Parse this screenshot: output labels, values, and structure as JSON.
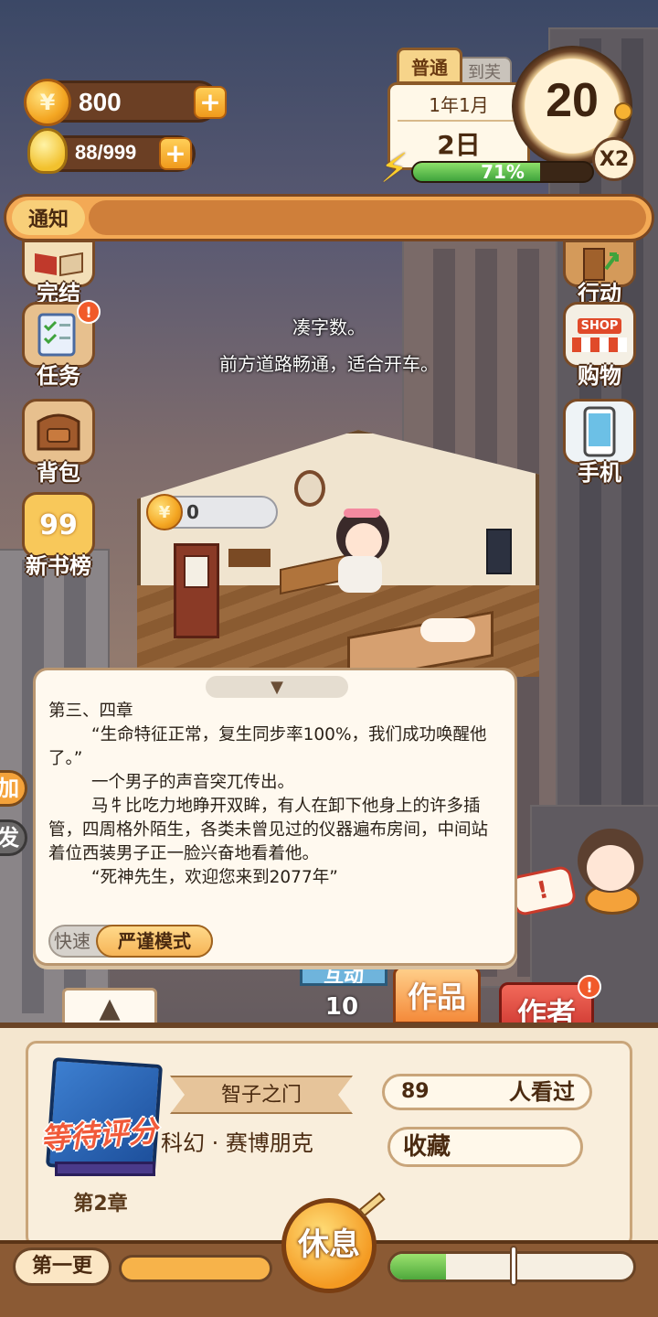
{
  "resources": {
    "coins": "800",
    "bulbs": "88/999",
    "coin_glyph": "¥"
  },
  "date": {
    "mode_active": "普通",
    "mode_inactive": "到芙",
    "year_month": "1年1月",
    "day": "2日",
    "clock_value": "20",
    "speed": "X2",
    "energy_percent": "71%",
    "energy_fraction": 0.71
  },
  "notice": {
    "label": "通知"
  },
  "left_menu": [
    {
      "label": "完结",
      "icon": "book-open-icon"
    },
    {
      "label": "任务",
      "icon": "checklist-icon"
    },
    {
      "label": "背包",
      "icon": "backpack-icon"
    },
    {
      "label": "新书榜",
      "icon": "ranking-medal-icon",
      "badge": "99"
    }
  ],
  "right_menu": [
    {
      "label": "行动",
      "icon": "door-arrow-icon"
    },
    {
      "label": "购物",
      "icon": "shop-icon",
      "sign": "SHOP"
    },
    {
      "label": "手机",
      "icon": "phone-icon"
    }
  ],
  "floating_text": {
    "line1": "凑字数。",
    "line2": "前方道路畅通，适合开车。"
  },
  "room": {
    "coin_count": "0"
  },
  "manuscript": {
    "text": "第三、四章\n        “生命特征正常，复生同步率100%，我们成功唤醒他了。”\n        一个男子的声音突兀传出。\n        马牜比吃力地睁开双眸，有人在卸下他身上的许多插管，四周格外陌生，各类未曾见过的仪器遍布房间，中间站着位西装男子正一脸兴奋地看着他。\n        “死神先生，欢迎您来到2077年”",
    "mode_fast": "快速",
    "mode_strict": "严谨模式",
    "collapse_glyph": "▼",
    "expand_glyph": "▲"
  },
  "tabs": {
    "interact_label": "互动",
    "interact_count": "10",
    "works": "作品",
    "author": "作者"
  },
  "side_partial": {
    "a": "加",
    "b": "发"
  },
  "book": {
    "status": "等待评分",
    "chapter": "第2章",
    "title": "智子之门",
    "genre": "科幻 · 赛博朋克",
    "views": "89",
    "views_label": "人看过",
    "favorites_label": "收藏"
  },
  "bottom": {
    "update_label": "第一更",
    "rest_label": "休息",
    "progress_fraction": 0.23
  },
  "colors": {
    "accent_orange": "#f4a23a",
    "brown": "#6a4426",
    "green": "#4ea83c",
    "alert_red": "#f15a2a"
  }
}
